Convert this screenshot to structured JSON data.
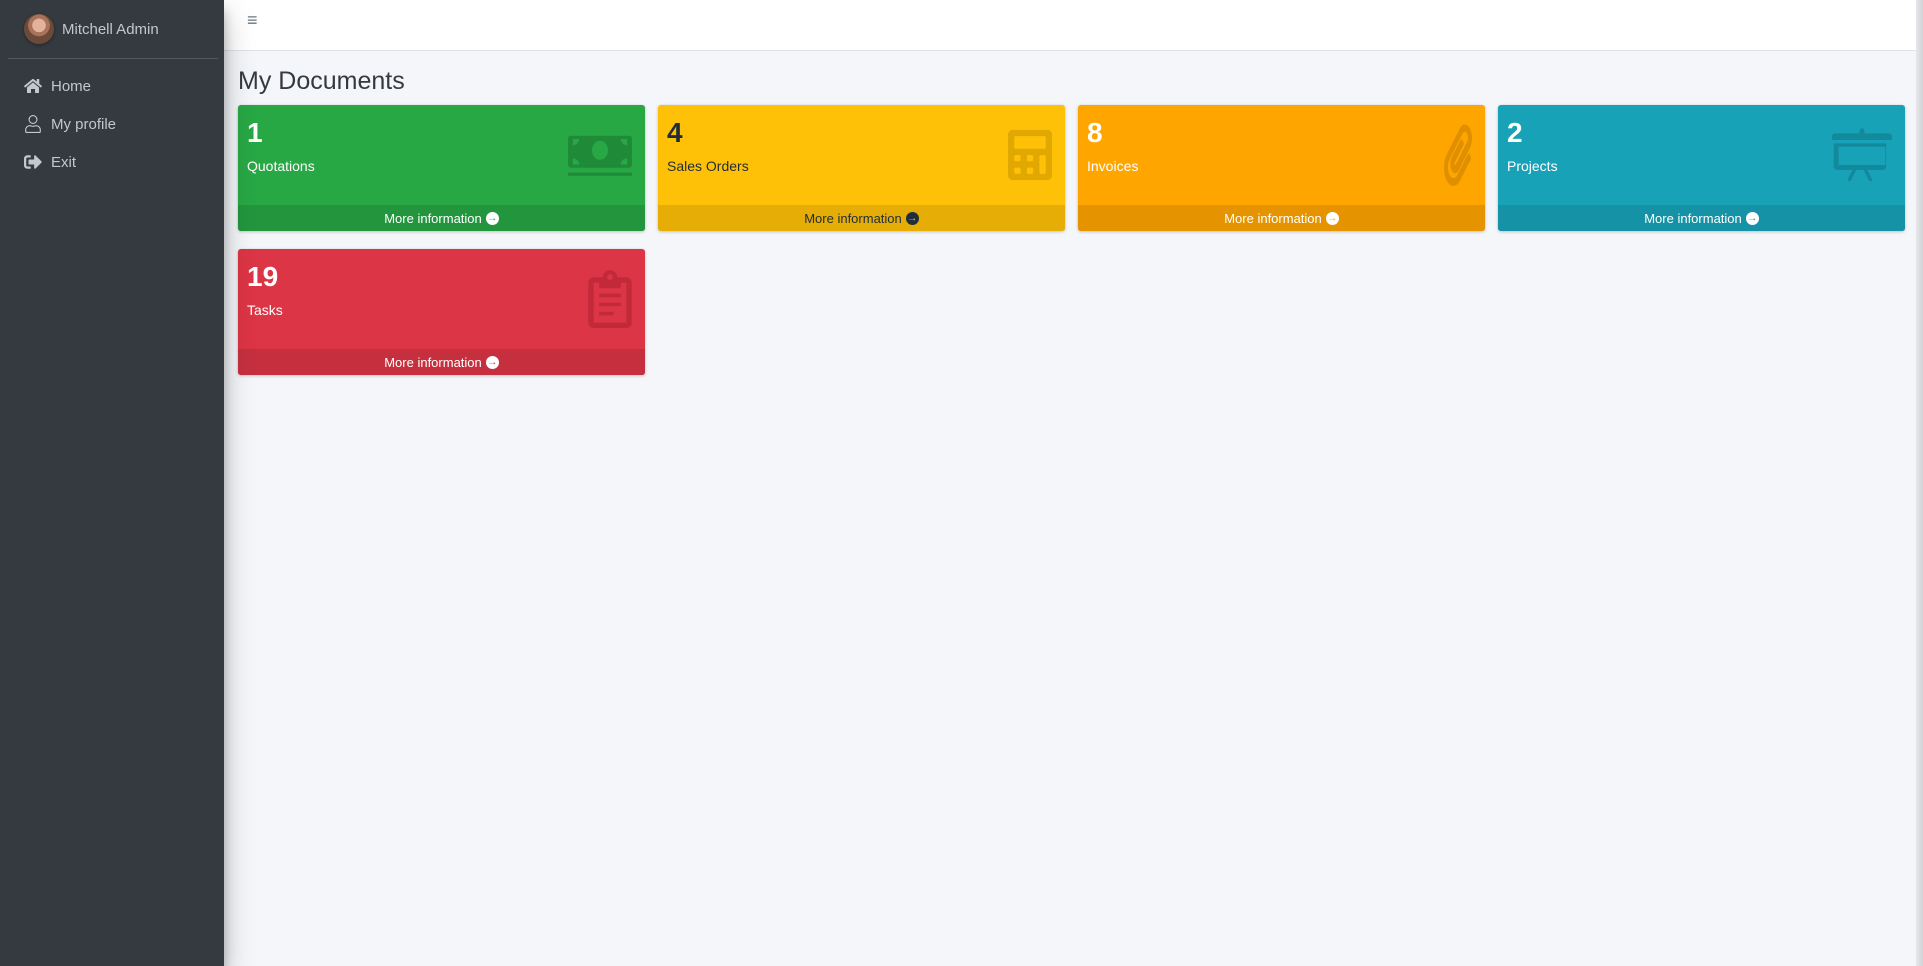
{
  "sidebar": {
    "user_name": "Mitchell Admin",
    "items": [
      {
        "label": "Home",
        "icon": "home-icon"
      },
      {
        "label": "My profile",
        "icon": "user-icon"
      },
      {
        "label": "Exit",
        "icon": "sign-out-icon"
      }
    ]
  },
  "topbar": {
    "menu_icon": "bars-icon",
    "menu_glyph": "≡"
  },
  "main": {
    "title": "My Documents",
    "cards": [
      {
        "count": "1",
        "label": "Quotations",
        "footer": "More information",
        "color": "#28a745",
        "icon": "money-bill-icon"
      },
      {
        "count": "4",
        "label": "Sales Orders",
        "footer": "More information",
        "color": "#ffc107",
        "icon": "calculator-icon"
      },
      {
        "count": "8",
        "label": "Invoices",
        "footer": "More information",
        "color": "#ffa500",
        "icon": "paperclip-icon"
      },
      {
        "count": "2",
        "label": "Projects",
        "footer": "More information",
        "color": "#17a2b8",
        "icon": "presentation-board-icon"
      },
      {
        "count": "19",
        "label": "Tasks",
        "footer": "More information",
        "color": "#dc3545",
        "icon": "clipboard-icon"
      }
    ]
  }
}
